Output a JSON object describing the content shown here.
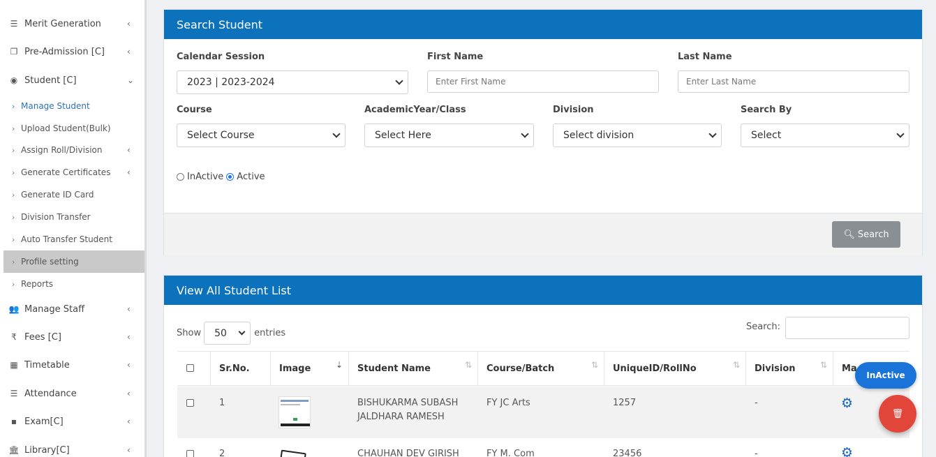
{
  "sidebar": {
    "items_top": [
      {
        "label": "Merit Generation",
        "icon": "list-icon"
      },
      {
        "label": "Pre-Admission [C]",
        "icon": "copy-icon"
      },
      {
        "label": "Student [C]",
        "icon": "user-circle-icon"
      }
    ],
    "student_sub": [
      {
        "label": "Manage Student"
      },
      {
        "label": "Upload Student(Bulk)"
      },
      {
        "label": "Assign Roll/Division"
      },
      {
        "label": "Generate Certificates"
      },
      {
        "label": "Generate ID Card"
      },
      {
        "label": "Division Transfer"
      },
      {
        "label": "Auto Transfer Student"
      },
      {
        "label": "Profile setting"
      },
      {
        "label": "Reports"
      }
    ],
    "items_bottom": [
      {
        "label": "Manage Staff",
        "icon": "users-icon"
      },
      {
        "label": "Fees [C]",
        "icon": "rupee-icon"
      },
      {
        "label": "Timetable",
        "icon": "calendar-icon"
      },
      {
        "label": "Attendance",
        "icon": "list-icon"
      },
      {
        "label": "Exam[C]",
        "icon": "note-icon"
      },
      {
        "label": "Library[C]",
        "icon": "bank-icon"
      }
    ]
  },
  "search": {
    "title": "Search Student",
    "calendar_label": "Calendar Session",
    "calendar_value": "2023 | 2023-2024",
    "first_name_label": "First Name",
    "first_name_placeholder": "Enter First Name",
    "last_name_label": "Last Name",
    "last_name_placeholder": "Enter Last Name",
    "course_label": "Course",
    "course_value": "Select Course",
    "year_label": "AcademicYear/Class",
    "year_value": "Select Here",
    "division_label": "Division",
    "division_value": "Select division",
    "search_by_label": "Search By",
    "search_by_value": "Select",
    "radio_inactive": "InActive",
    "radio_active": "Active",
    "button": "Search"
  },
  "list": {
    "title": "View All Student List",
    "show_label": "Show",
    "entries_value": "50",
    "entries_label": "entries",
    "search_label": "Search:",
    "columns": [
      "Sr.No.",
      "Image",
      "Student Name",
      "Course/Batch",
      "UniqueID/RollNo",
      "Division",
      "Ma"
    ],
    "rows": [
      {
        "sr": "1",
        "name_line1": "BISHUKARMA SUBASH",
        "name_line2": "JALDHARA RAMESH",
        "course": "FY JC Arts",
        "uid": "1257",
        "division": "-"
      },
      {
        "sr": "2",
        "name_line1": "CHAUHAN DEV GIRISH",
        "name_line2": "",
        "course": "FY M. Com",
        "uid": "23456",
        "division": "-"
      }
    ]
  },
  "fab": {
    "inactive": "InActive"
  }
}
